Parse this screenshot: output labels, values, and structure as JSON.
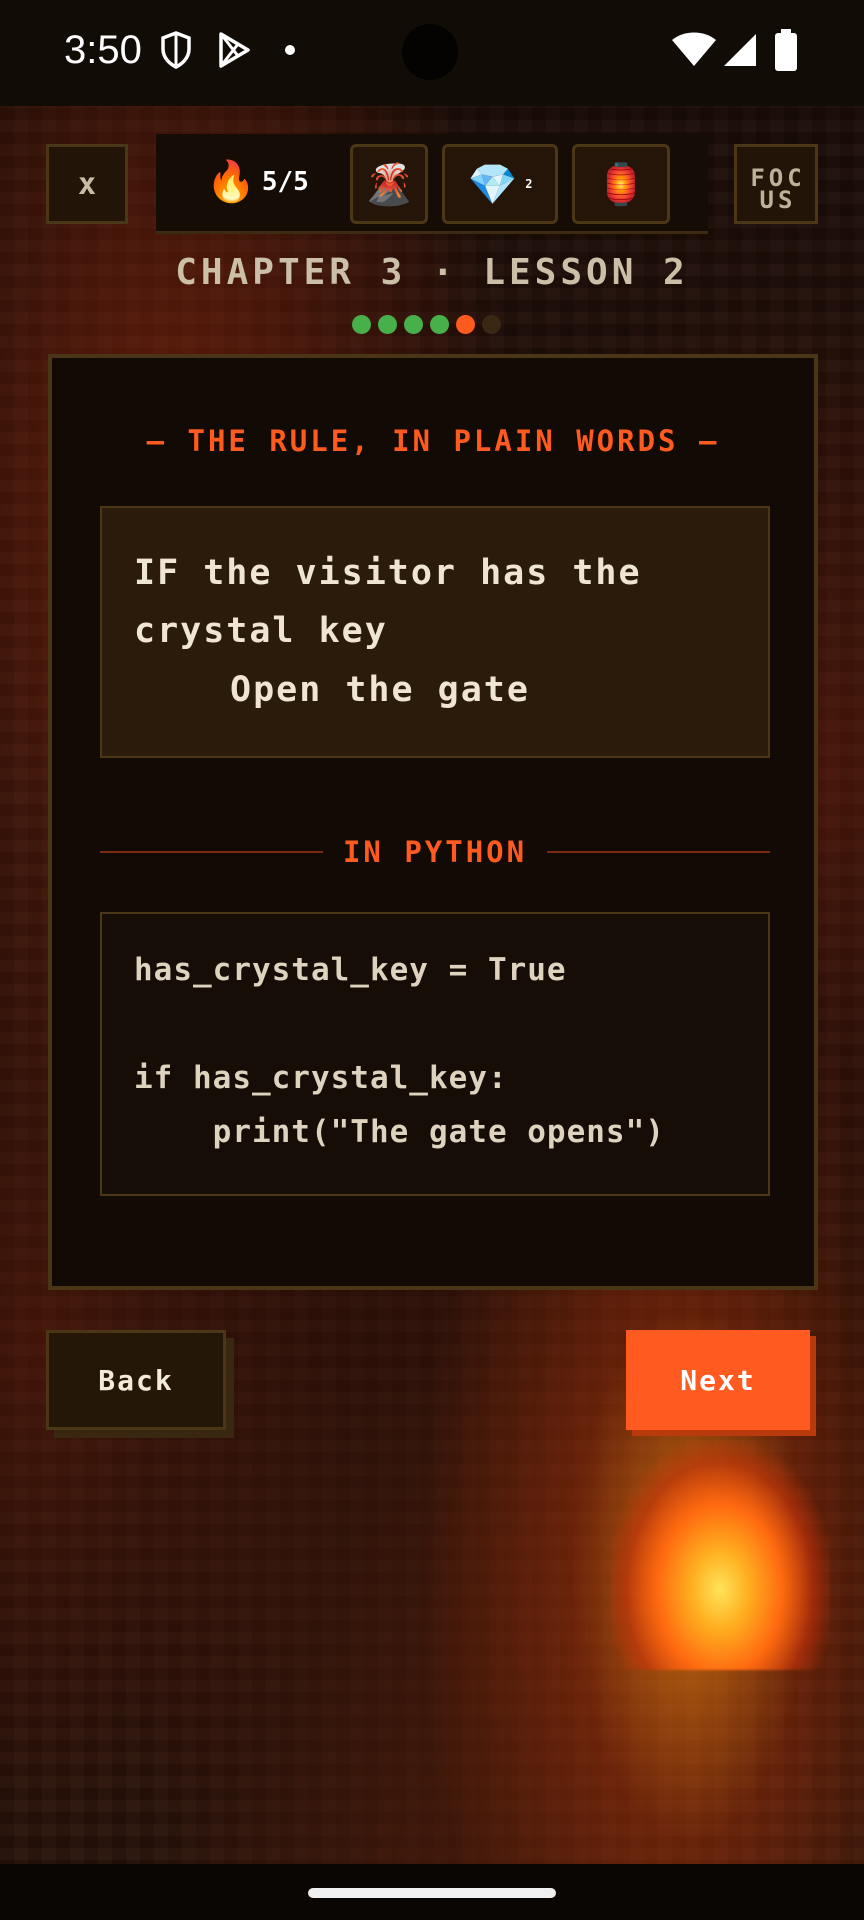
{
  "status_bar": {
    "time": "3:50",
    "icons": [
      "shield-icon",
      "play-store-icon",
      "dot-icon",
      "wifi-icon",
      "signal-icon",
      "battery-icon"
    ]
  },
  "top_bar": {
    "close_label": "x",
    "streak_icon": "fire-icon",
    "streak_text": "5/5",
    "items": [
      {
        "name": "volcano-icon",
        "glyph": "🌋"
      },
      {
        "name": "gem-icon",
        "glyph": "💎",
        "count": "2"
      },
      {
        "name": "lantern-icon",
        "glyph": "🏮"
      }
    ],
    "focus_label": "FOCUS"
  },
  "lesson": {
    "chapter_label": "CHAPTER 3 · LESSON 2",
    "progress": {
      "total": 6,
      "completed": 4,
      "current": 5
    }
  },
  "card": {
    "rule_title": "— THE RULE, IN PLAIN WORDS —",
    "rule_line1": "IF the visitor has the crystal key",
    "rule_line2": "Open the gate",
    "python_title": "IN PYTHON",
    "code": [
      "has_crystal_key = True",
      "",
      "if has_crystal_key:",
      "    print(\"The gate opens\")"
    ]
  },
  "buttons": {
    "back": "Back",
    "next": "Next"
  },
  "colors": {
    "accent": "#ff5a1f",
    "progress_done": "#47b04b",
    "card_border": "#4a3616"
  }
}
